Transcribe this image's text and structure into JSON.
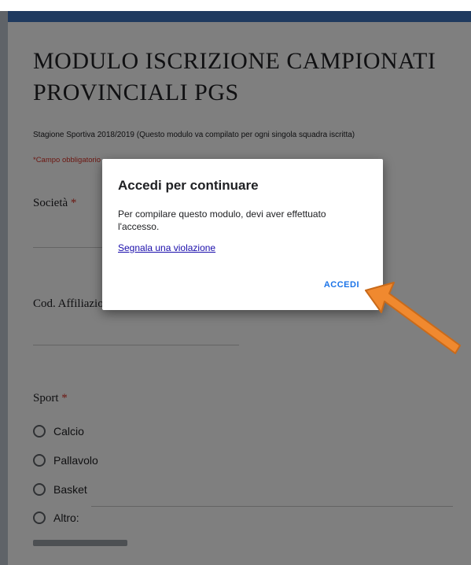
{
  "form": {
    "title": "MODULO ISCRIZIONE CAMPIONATI PROVINCIALI PGS",
    "description": "Stagione Sportiva 2018/2019 (Questo modulo va compilato per ogni singola squadra iscritta)",
    "required_note": "*Campo obbligatorio",
    "questions": [
      {
        "label": "Società",
        "required": "*"
      },
      {
        "label": "Cod. Affiliazione",
        "required": ""
      },
      {
        "label": "Sport",
        "required": "*"
      }
    ],
    "sport_options": [
      "Calcio",
      "Pallavolo",
      "Basket",
      "Altro:"
    ]
  },
  "dialog": {
    "title": "Accedi per continuare",
    "body": "Per compilare questo modulo, devi aver effettuato l'accesso.",
    "link": "Segnala una violazione",
    "button": "ACCEDI"
  },
  "colors": {
    "header_bar": "#1f3a5f",
    "required_red": "#d93025",
    "button_blue": "#1a73e8",
    "arrow_orange": "#f0892f"
  }
}
